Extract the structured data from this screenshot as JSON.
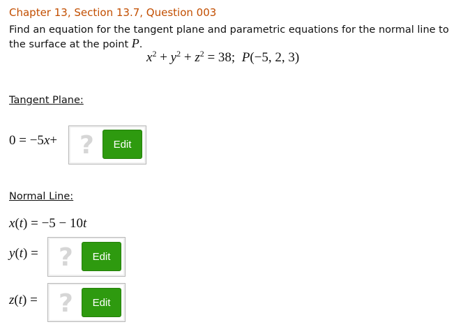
{
  "question": {
    "title": "Chapter 13, Section 13.7, Question 003",
    "prompt_text": "Find an equation for the tangent plane and parametric equations for the normal line to the surface at the point ",
    "point_symbol": "P",
    "prompt_end": "."
  },
  "equation": {
    "x": "x",
    "y": "y",
    "z": "z",
    "exponent": "2",
    "plus": "+",
    "rhs": "= 38;",
    "point_name": "P",
    "point_coords": "(−5, 2, 3)"
  },
  "tangent_plane": {
    "label": "Tangent Plane:",
    "expression_prefix": "0 = −5",
    "expression_var": "x",
    "expression_suffix": "+",
    "placeholder_glyph": "?",
    "edit_label": "Edit"
  },
  "normal_line": {
    "label": "Normal Line:",
    "x_lhs": "x",
    "x_arg": "(",
    "x_t": "t",
    "x_rhs": ") = −5 − 10",
    "x_t2": "t",
    "y_var": "y",
    "y_open": "(",
    "y_t": "t",
    "y_close": ") =",
    "z_var": "z",
    "z_open": "(",
    "z_t": "t",
    "z_close": ") =",
    "placeholder_glyph": "?",
    "edit_label": "Edit"
  }
}
